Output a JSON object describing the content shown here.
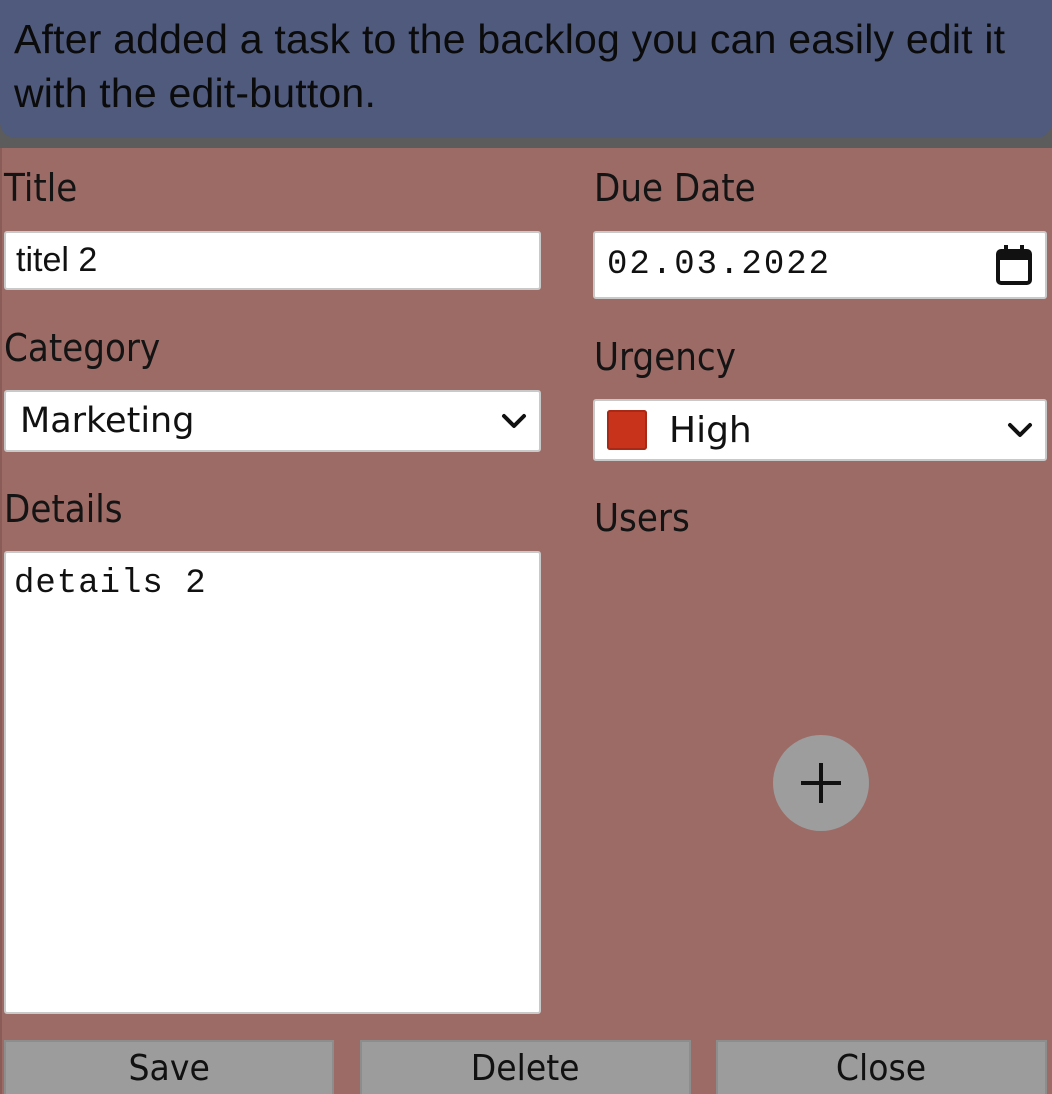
{
  "tip": {
    "text": "After added a task to the backlog you can easily edit it with the edit-button."
  },
  "form": {
    "title_label": "Title",
    "title_value": "titel 2",
    "due_date_label": "Due Date",
    "due_date_value": "02.03.2022",
    "category_label": "Category",
    "category_value": "Marketing",
    "urgency_label": "Urgency",
    "urgency_value": "High",
    "urgency_color": "#c8331c",
    "details_label": "Details",
    "details_value": "details 2",
    "users_label": "Users",
    "add_user_icon": "plus-icon"
  },
  "buttons": {
    "save": "Save",
    "delete": "Delete",
    "close": "Close"
  },
  "colors": {
    "banner": "#4f5a7c",
    "modal_background": "#9c6b66",
    "button": "#9c9c9c"
  }
}
